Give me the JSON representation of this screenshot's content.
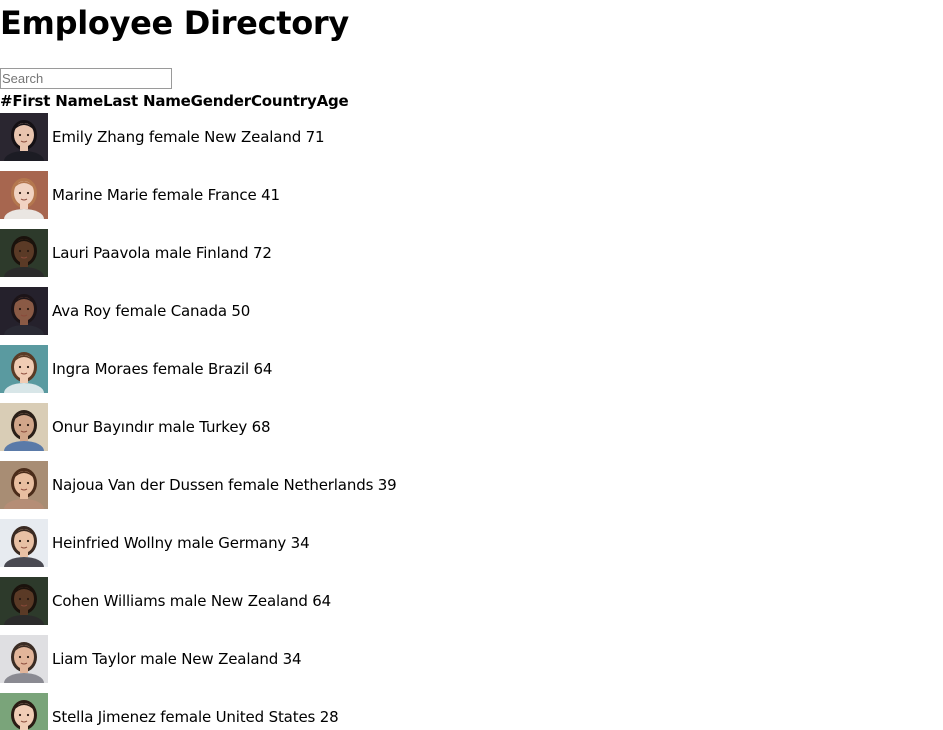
{
  "page": {
    "title": "Employee Directory"
  },
  "search": {
    "placeholder": "Search",
    "value": ""
  },
  "table": {
    "headers": [
      "#",
      "First Name",
      "Last Name",
      "Gender",
      "Country",
      "Age"
    ],
    "rows": [
      {
        "first": "Emily",
        "last": "Zhang",
        "gender": "female",
        "country": "New Zealand",
        "age": "71",
        "avatar": {
          "bg": "#2a2630",
          "skin": "#e8c4ae",
          "hair": "#141014",
          "shirt": "#1c1c24"
        }
      },
      {
        "first": "Marine",
        "last": "Marie",
        "gender": "female",
        "country": "France",
        "age": "41",
        "avatar": {
          "bg": "#a7664f",
          "skin": "#f1d3c2",
          "hair": "#b4774e",
          "shirt": "#eae6e2"
        }
      },
      {
        "first": "Lauri",
        "last": "Paavola",
        "gender": "male",
        "country": "Finland",
        "age": "72",
        "avatar": {
          "bg": "#2d3a2b",
          "skin": "#5a3a26",
          "hair": "#1a120c",
          "shirt": "#2b2b2b"
        }
      },
      {
        "first": "Ava",
        "last": "Roy",
        "gender": "female",
        "country": "Canada",
        "age": "50",
        "avatar": {
          "bg": "#25212c",
          "skin": "#8a5a45",
          "hair": "#1c1418",
          "shirt": "#2a2a34"
        }
      },
      {
        "first": "Ingra",
        "last": "Moraes",
        "gender": "female",
        "country": "Brazil",
        "age": "64",
        "avatar": {
          "bg": "#5a9aa0",
          "skin": "#f0ccb4",
          "hair": "#5a3b26",
          "shirt": "#d8e6e8"
        }
      },
      {
        "first": "Onur",
        "last": "Bayındır",
        "gender": "male",
        "country": "Turkey",
        "age": "68",
        "avatar": {
          "bg": "#d9cdb6",
          "skin": "#d1a68a",
          "hair": "#2a1f18",
          "shirt": "#5a7aa8"
        }
      },
      {
        "first": "Najoua",
        "last": "Van der Dussen",
        "gender": "female",
        "country": "Netherlands",
        "age": "39",
        "avatar": {
          "bg": "#a88d74",
          "skin": "#e8bea0",
          "hair": "#4a2c1a",
          "shirt": "#b58d76"
        }
      },
      {
        "first": "Heinfried",
        "last": "Wollny",
        "gender": "male",
        "country": "Germany",
        "age": "34",
        "avatar": {
          "bg": "#e7ebf0",
          "skin": "#e8c0a4",
          "hair": "#3a2a22",
          "shirt": "#4a4a52"
        }
      },
      {
        "first": "Cohen",
        "last": "Williams",
        "gender": "male",
        "country": "New Zealand",
        "age": "64",
        "avatar": {
          "bg": "#2d3a2b",
          "skin": "#5a3a26",
          "hair": "#1a120c",
          "shirt": "#2b2b2b"
        }
      },
      {
        "first": "Liam",
        "last": "Taylor",
        "gender": "male",
        "country": "New Zealand",
        "age": "34",
        "avatar": {
          "bg": "#dfdfe2",
          "skin": "#e2b59a",
          "hair": "#3a2c24",
          "shirt": "#8a8a92"
        }
      },
      {
        "first": "Stella",
        "last": "Jimenez",
        "gender": "female",
        "country": "United States",
        "age": "28",
        "avatar": {
          "bg": "#7aa47a",
          "skin": "#f0cdb6",
          "hair": "#2a1c14",
          "shirt": "#ffffff"
        }
      }
    ]
  }
}
